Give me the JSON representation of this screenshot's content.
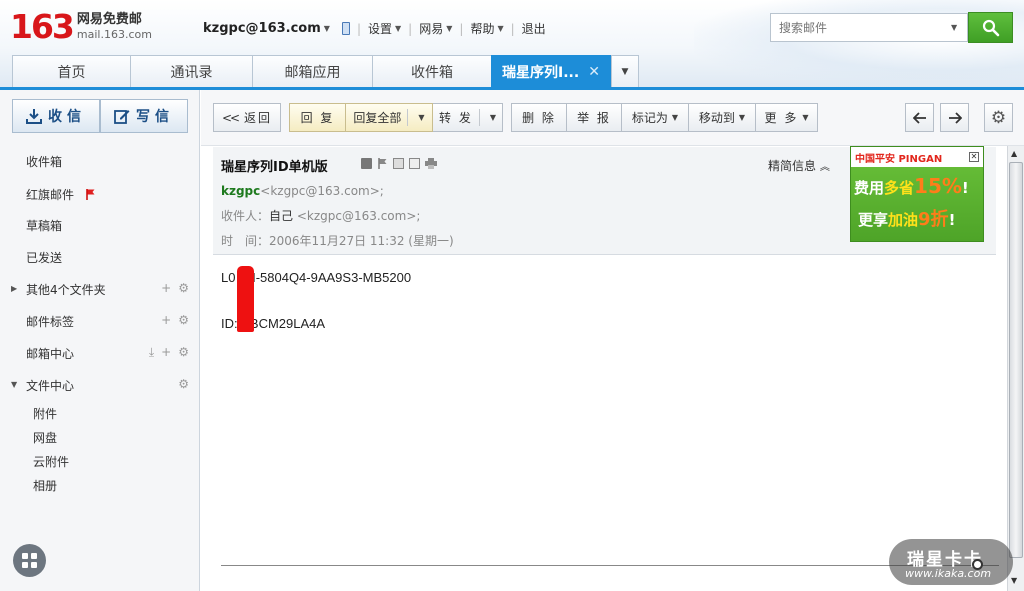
{
  "logo": {
    "number": "163",
    "cn": "网易免费邮",
    "domain": "mail.163.com"
  },
  "topnav": {
    "account": "kzgpc@163.com",
    "items": [
      "设置",
      "网易",
      "帮助"
    ],
    "logout": "退出"
  },
  "search": {
    "placeholder": "搜索邮件"
  },
  "tabs": [
    {
      "label": "首页"
    },
    {
      "label": "通讯录"
    },
    {
      "label": "邮箱应用"
    },
    {
      "label": "收件箱"
    },
    {
      "label": "瑞星序列I..."
    }
  ],
  "sidebar": {
    "receive": "收信",
    "compose": "写信",
    "items": [
      "收件箱",
      "红旗邮件",
      "草稿箱",
      "已发送",
      "其他4个文件夹",
      "邮件标签",
      "邮箱中心",
      "文件中心"
    ],
    "sub": [
      "附件",
      "网盘",
      "云附件",
      "相册"
    ]
  },
  "toolbar": {
    "back": "返回",
    "reply": "回 复",
    "reply_all": "回复全部",
    "forward": "转 发",
    "delete": "删 除",
    "report": "举 报",
    "mark_as": "标记为",
    "move_to": "移动到",
    "more": "更 多"
  },
  "mail": {
    "subject": "瑞星序列ID单机版",
    "brief_info": "精简信息",
    "from_name": "kzgpc",
    "from_addr": "<kzgpc@163.com>;",
    "to_label": "收件人：",
    "to_name": "自己",
    "to_addr": "<kzgpc@163.com>;",
    "time_label": "时　间：",
    "time_value": "2006年11月27日 11:32 (星期一)",
    "body_line1": "L0   4H-5804Q4-9AA9S3-MB5200",
    "body_line2": "ID:   XBCM29LA4A"
  },
  "ad": {
    "brand": "中国平安 PINGAN",
    "l1a": "费用",
    "l1b": "多省",
    "l1c": "15%",
    "l1d": "!",
    "l2a": "更享",
    "l2b": "加油",
    "l2c": "9折",
    "l2d": "!"
  },
  "watermark": {
    "cn": "瑞星卡卡",
    "url": "www.ikaka.com"
  },
  "colors": {
    "accent": "#1d8dd8",
    "logo_red": "#d8161a",
    "search_green": "#4caf2e",
    "sender_green": "#1e7a1e"
  }
}
